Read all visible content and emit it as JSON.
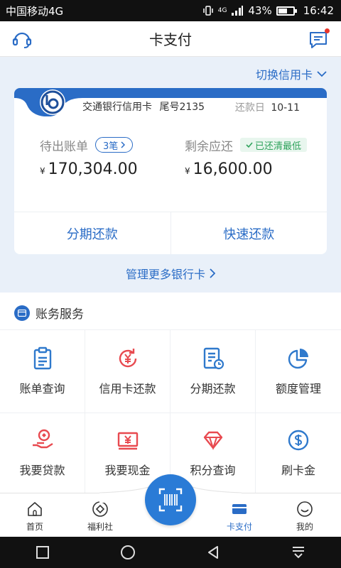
{
  "status": {
    "carrier": "中国移动4G",
    "signal": "4G",
    "battery": "43%",
    "time": "16:42"
  },
  "navbar": {
    "title": "卡支付"
  },
  "card_switch": {
    "label": "切换信用卡"
  },
  "card": {
    "bank_name": "交通银行信用卡",
    "tail": "尾号2135",
    "due_label": "还款日",
    "due_value": "10-11",
    "pending_label": "待出账单",
    "pending_count": "3笔",
    "pending_currency": "¥",
    "pending_amount": "170,304.00",
    "remaining_label": "剩余应还",
    "remaining_badge": "已还清最低",
    "remaining_currency": "¥",
    "remaining_amount": "16,600.00",
    "action_installment": "分期还款",
    "action_quick": "快速还款"
  },
  "more_cards": {
    "label": "管理更多银行卡"
  },
  "services": {
    "title": "账务服务",
    "items": [
      {
        "label": "账单查询"
      },
      {
        "label": "信用卡还款"
      },
      {
        "label": "分期还款"
      },
      {
        "label": "额度管理"
      },
      {
        "label": "我要贷款"
      },
      {
        "label": "我要现金"
      },
      {
        "label": "积分查询"
      },
      {
        "label": "刷卡金"
      }
    ]
  },
  "tabs": [
    {
      "label": "首页"
    },
    {
      "label": "福利社"
    },
    {
      "label": "卡支付"
    },
    {
      "label": "我的"
    }
  ],
  "colors": {
    "accent": "#2a6cc6",
    "icon_blue": "#2f79cc",
    "icon_red": "#e84a50",
    "green": "#2fa35c"
  }
}
